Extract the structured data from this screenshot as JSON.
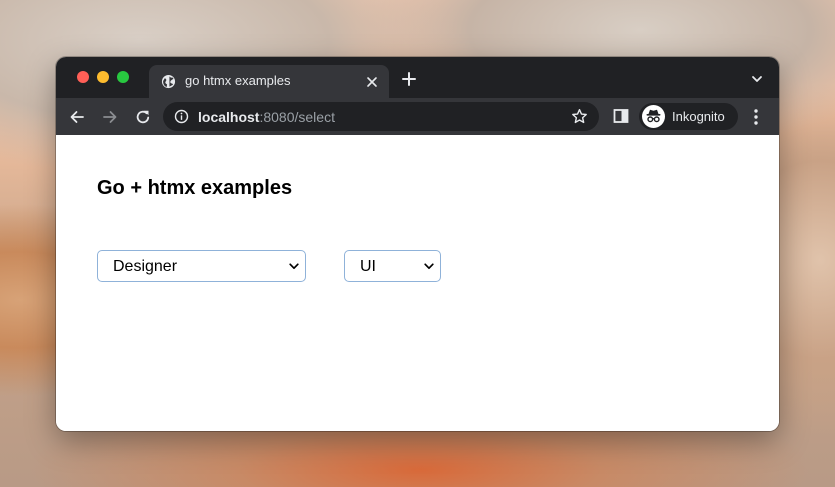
{
  "browser": {
    "tab": {
      "title": "go htmx examples",
      "favicon": "globe-icon",
      "close_icon": "close-icon"
    },
    "new_tab_icon": "plus-icon",
    "tab_search_icon": "chevron-down-icon",
    "toolbar": {
      "back_icon": "back-arrow-icon",
      "forward_icon": "forward-arrow-icon",
      "reload_icon": "reload-icon",
      "site_info_icon": "info-icon",
      "url_host": "localhost",
      "url_rest": ":8080/select",
      "bookmark_icon": "star-icon",
      "side_panel_icon": "side-panel-icon",
      "profile": {
        "label": "Inkognito",
        "icon": "incognito-icon"
      },
      "menu_icon": "more-vertical-icon"
    }
  },
  "page": {
    "heading": "Go + htmx examples",
    "selects": [
      {
        "value": "Designer",
        "icon": "chevron-down-icon"
      },
      {
        "value": "UI",
        "icon": "chevron-down-icon"
      }
    ]
  },
  "colors": {
    "tab_strip": "#202124",
    "toolbar": "#35363a",
    "traffic_red": "#ff5f57",
    "traffic_yellow": "#febc2e",
    "traffic_green": "#28c840",
    "select_border": "#8fb2d9"
  }
}
